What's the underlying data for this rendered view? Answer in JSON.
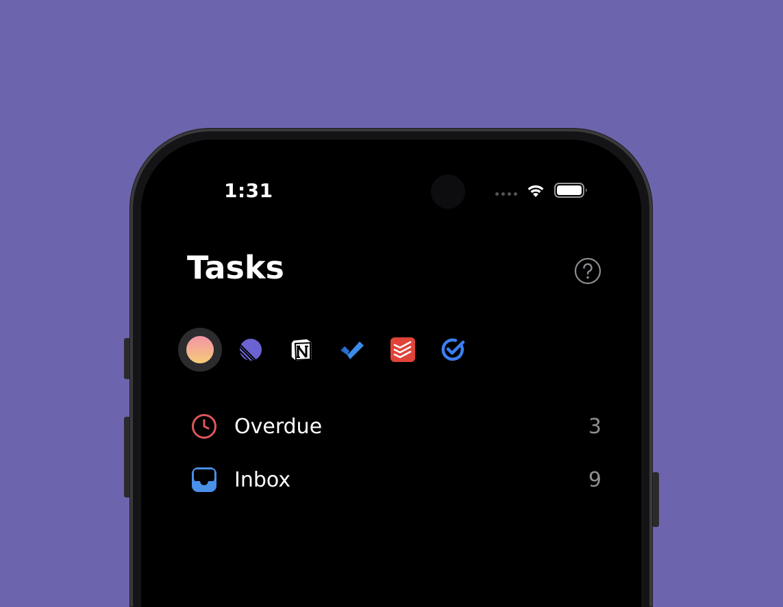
{
  "status_bar": {
    "time": "1:31"
  },
  "header": {
    "title": "Tasks",
    "help_icon": "question-circle-icon"
  },
  "sources": [
    {
      "name": "all-sources",
      "icon": "gradient-circle-icon",
      "active": true
    },
    {
      "name": "linear",
      "icon": "linear-logo-icon",
      "active": false
    },
    {
      "name": "notion",
      "icon": "notion-logo-icon",
      "active": false
    },
    {
      "name": "microsoft-todo",
      "icon": "checkmark-logo-icon",
      "active": false
    },
    {
      "name": "todoist",
      "icon": "todoist-logo-icon",
      "active": false
    },
    {
      "name": "ticktick",
      "icon": "ticktick-logo-icon",
      "active": false
    }
  ],
  "lists": [
    {
      "label": "Overdue",
      "count": "3",
      "icon": "clock-icon",
      "color": "#e0565c"
    },
    {
      "label": "Inbox",
      "count": "9",
      "icon": "inbox-tray-icon",
      "color": "#4a8fe8"
    }
  ],
  "colors": {
    "background": "#6c64ad",
    "screen": "#000000",
    "overdue": "#e0565c",
    "inbox": "#4a8fe8"
  }
}
